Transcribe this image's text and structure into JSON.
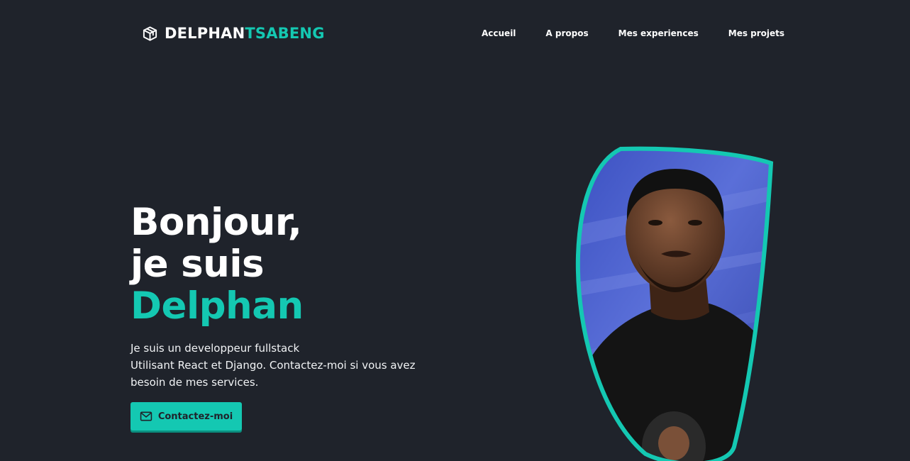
{
  "header": {
    "logo": {
      "icon": "cube-icon",
      "name_first": "DELPHAN",
      "name_last": "TSABENG"
    },
    "nav": [
      {
        "label": "Accueil"
      },
      {
        "label": "A propos"
      },
      {
        "label": "Mes experiences"
      },
      {
        "label": "Mes projets"
      }
    ]
  },
  "hero": {
    "title_line1": "Bonjour,",
    "title_line2": "je suis",
    "title_name": "Delphan",
    "description_line1": "Je suis un developpeur fullstack",
    "description_line2": "Utilisant React et Django. Contactez-moi si vous avez",
    "description_line3": "besoin de mes services.",
    "contact_button": {
      "icon": "mail-icon",
      "label": "Contactez-moi"
    }
  },
  "portrait": {
    "frame_color": "#14c8b2"
  },
  "colors": {
    "background": "#1f232b",
    "accent": "#14c8b2",
    "text": "#ffffff"
  }
}
